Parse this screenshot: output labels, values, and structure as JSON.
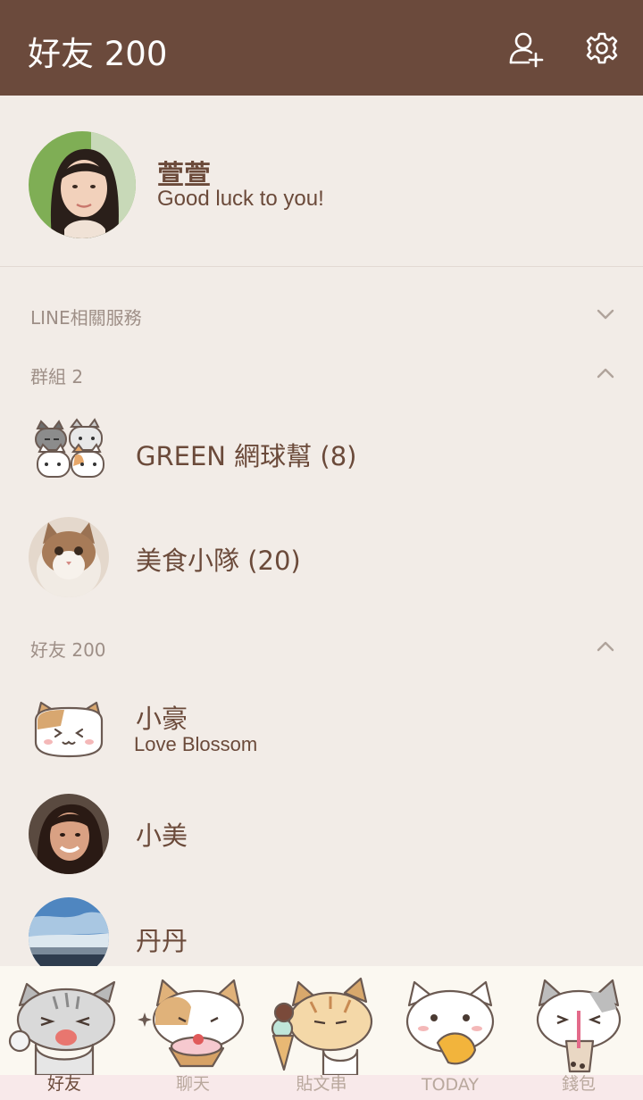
{
  "header": {
    "title": "好友 200",
    "icons": {
      "add_friend": "add-friend-icon",
      "settings": "gear-icon"
    }
  },
  "profile": {
    "name": "萱萱",
    "status": "Good luck to you!"
  },
  "sections": {
    "services": {
      "label": "LINE相關服務",
      "expanded": false
    },
    "groups": {
      "label": "群組 2",
      "expanded": true
    },
    "friends": {
      "label": "好友 200",
      "expanded": true
    }
  },
  "groups": [
    {
      "name": "GREEN 網球幫 (8)"
    },
    {
      "name": "美食小隊 (20)"
    }
  ],
  "friends": [
    {
      "name": "小豪",
      "status": "Love Blossom"
    },
    {
      "name": "小美"
    },
    {
      "name": "丹丹"
    }
  ],
  "tabs": [
    {
      "label": "好友",
      "active": true
    },
    {
      "label": "聊天"
    },
    {
      "label": "貼文串"
    },
    {
      "label": "TODAY"
    },
    {
      "label": "錢包"
    }
  ],
  "colors": {
    "header_bg": "#6b4a3c",
    "page_bg": "#f2ece7",
    "text_primary": "#6b4a3a",
    "section_text": "#9e8f87"
  }
}
